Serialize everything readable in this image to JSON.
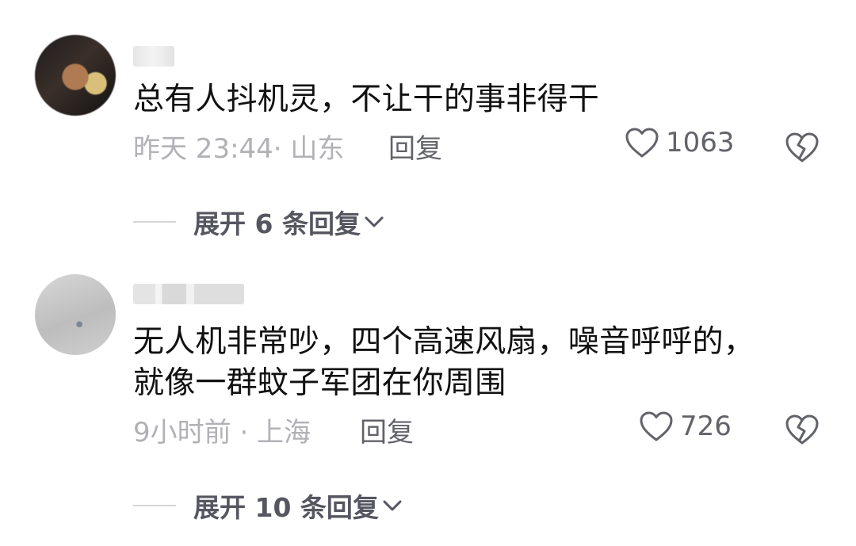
{
  "comments": [
    {
      "text": "总有人抖机灵，不让干的事非得干",
      "meta": "昨天 23:44· 山东",
      "reply_label": "回复",
      "like_count": "1063",
      "expand_label": "展开 6 条回复"
    },
    {
      "text": "无人机非常吵，四个高速风扇，噪音呼呼的，\n就像一群蚊子军团在你周围",
      "meta": "9小时前 · 上海",
      "reply_label": "回复",
      "like_count": "726",
      "expand_label": "展开 10 条回复"
    }
  ],
  "icons": {
    "like": "heart-outline-icon",
    "dislike": "broken-heart-icon",
    "expand": "chevron-down-icon"
  },
  "colors": {
    "primary_text": "#111111",
    "meta_text": "#b1b1b6",
    "action_text": "#626369"
  }
}
